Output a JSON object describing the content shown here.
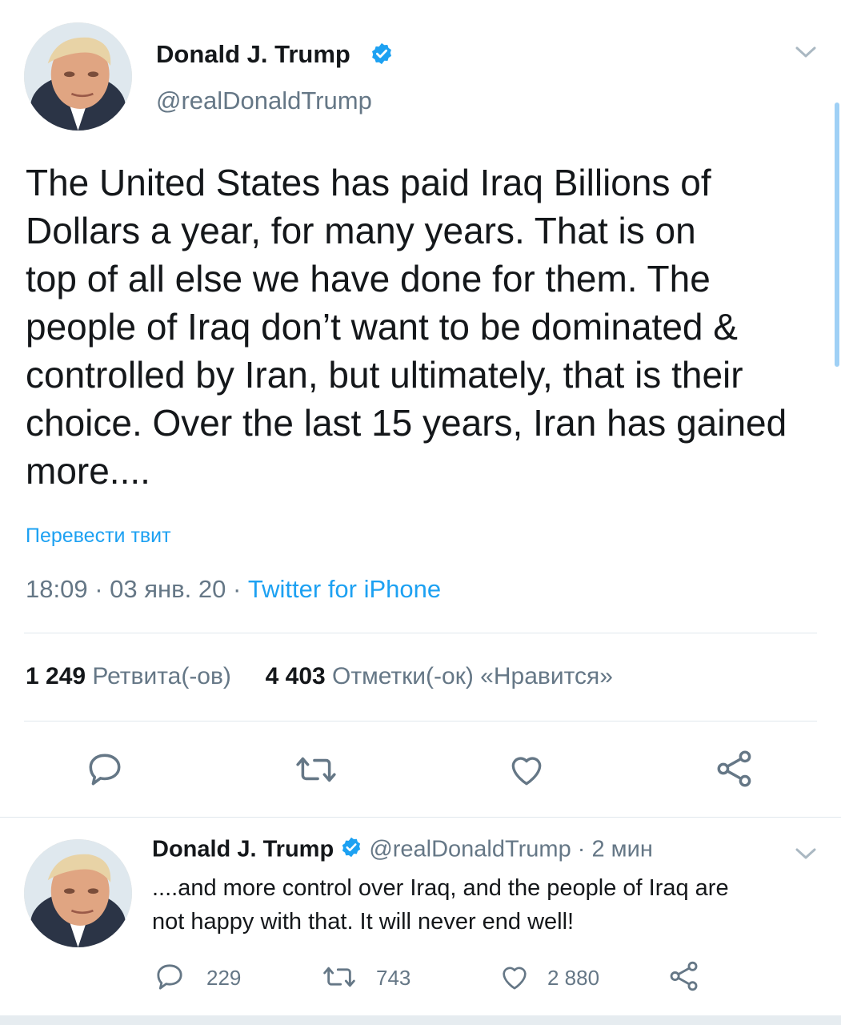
{
  "main_tweet": {
    "author_name": "Donald J. Trump",
    "handle": "@realDonaldTrump",
    "text_lines": [
      "The United States has paid Iraq Billions of",
      "Dollars a year, for many years. That is on",
      "top of all else we have done for them. The",
      "people of Iraq don’t want to be dominated &",
      "controlled by Iran, but ultimately, that is their",
      "choice. Over the last 15 years, Iran has gained",
      "more...."
    ],
    "translate_label": "Перевести твит",
    "time": "18:09",
    "sep": "·",
    "date": "03 янв. 20",
    "source": "Twitter for iPhone",
    "retweets_count": "1 249",
    "retweets_label": "Ретвита(-ов)",
    "likes_count": "4 403",
    "likes_label": "Отметки(-ок) «Нравится»"
  },
  "reply_tweet": {
    "author_name": "Donald J. Trump",
    "handle": "@realDonaldTrump",
    "time_ago": "· 2 мин",
    "text_lines": [
      "....and more control over Iraq, and the people of Iraq are",
      "not happy with that. It will never end well!"
    ],
    "reply_count": "229",
    "retweet_count": "743",
    "like_count": "2 880"
  },
  "colors": {
    "accent": "#1da1f2",
    "secondary_text": "#657786",
    "icon": "#657786",
    "divider": "#e1e8ed"
  },
  "icons": [
    "verified-badge-icon",
    "chevron-down-icon",
    "reply-icon",
    "retweet-icon",
    "like-icon",
    "share-icon"
  ]
}
